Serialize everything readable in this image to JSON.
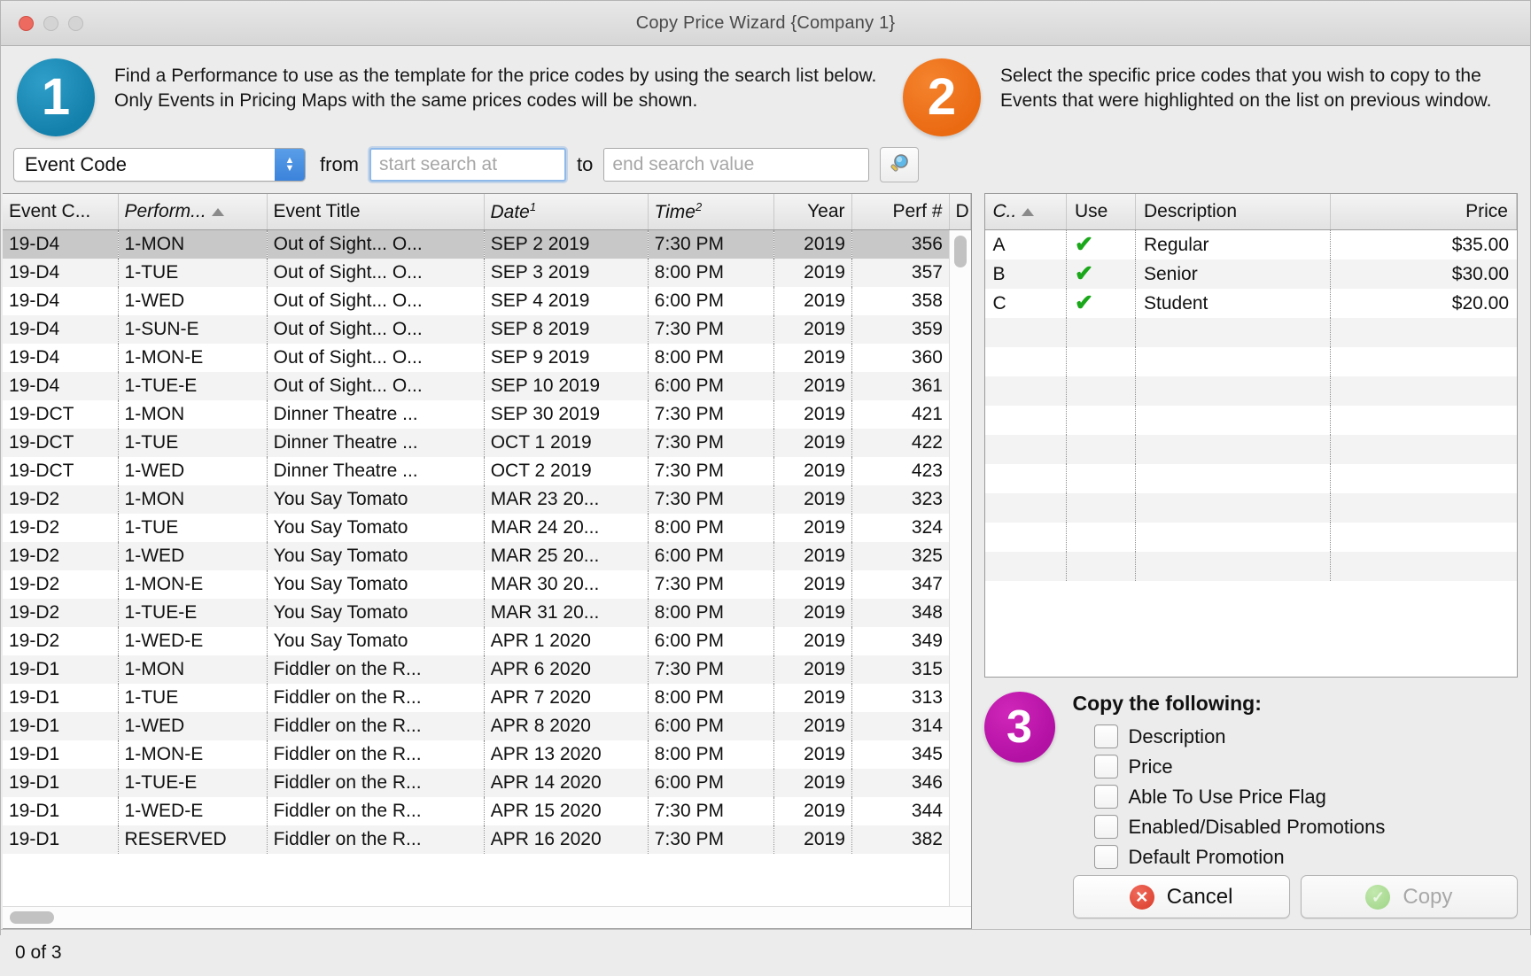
{
  "window": {
    "title": "Copy Price Wizard {Company 1}",
    "traffic_lights": [
      "close",
      "minimize",
      "zoom"
    ]
  },
  "steps": {
    "one": {
      "number": "1",
      "color": "#1380ab",
      "text": "Find a Performance to use as the template for the price codes by using the search list below.  Only Events in Pricing Maps  with the same prices codes will be shown."
    },
    "two": {
      "number": "2",
      "color": "#ea6a12",
      "text": "Select the specific price codes that you wish to copy to the Events that were highlighted on the list on previous window."
    },
    "three": {
      "number": "3",
      "color": "#b310a4",
      "title": "Copy the following:"
    }
  },
  "search": {
    "field_label": "Event Code",
    "from_label": "from",
    "to_label": "to",
    "from_placeholder": "start search at",
    "from_value": "",
    "to_placeholder": "end search value",
    "to_value": "",
    "search_icon": "magnifier-icon"
  },
  "events_table": {
    "columns": [
      {
        "label": "Event C...",
        "italic": false,
        "sup": "",
        "align": "left",
        "sorted": false
      },
      {
        "label": "Perform...",
        "italic": true,
        "sup": "",
        "align": "left",
        "sorted": true
      },
      {
        "label": "Event Title",
        "italic": false,
        "sup": "",
        "align": "left",
        "sorted": false
      },
      {
        "label": "Date",
        "italic": true,
        "sup": "1",
        "align": "left",
        "sorted": false
      },
      {
        "label": "Time",
        "italic": true,
        "sup": "2",
        "align": "left",
        "sorted": false
      },
      {
        "label": "Year",
        "italic": false,
        "sup": "",
        "align": "right",
        "sorted": false
      },
      {
        "label": "Perf #",
        "italic": false,
        "sup": "",
        "align": "right",
        "sorted": false
      },
      {
        "label": "D",
        "italic": false,
        "sup": "",
        "align": "left",
        "sorted": false
      }
    ],
    "rows": [
      {
        "event_code": "19-D4",
        "performance": "1-MON",
        "event_title": "Out of Sight... O...",
        "date": "SEP 2 2019",
        "time": "7:30 PM",
        "year": "2019",
        "perf": "356",
        "selected": true
      },
      {
        "event_code": "19-D4",
        "performance": "1-TUE",
        "event_title": "Out of Sight... O...",
        "date": "SEP 3 2019",
        "time": "8:00 PM",
        "year": "2019",
        "perf": "357",
        "selected": false
      },
      {
        "event_code": "19-D4",
        "performance": "1-WED",
        "event_title": "Out of Sight... O...",
        "date": "SEP 4 2019",
        "time": "6:00 PM",
        "year": "2019",
        "perf": "358",
        "selected": false
      },
      {
        "event_code": "19-D4",
        "performance": "1-SUN-E",
        "event_title": "Out of Sight... O...",
        "date": "SEP 8 2019",
        "time": "7:30 PM",
        "year": "2019",
        "perf": "359",
        "selected": false
      },
      {
        "event_code": "19-D4",
        "performance": "1-MON-E",
        "event_title": "Out of Sight... O...",
        "date": "SEP 9 2019",
        "time": "8:00 PM",
        "year": "2019",
        "perf": "360",
        "selected": false
      },
      {
        "event_code": "19-D4",
        "performance": "1-TUE-E",
        "event_title": "Out of Sight... O...",
        "date": "SEP 10 2019",
        "time": "6:00 PM",
        "year": "2019",
        "perf": "361",
        "selected": false
      },
      {
        "event_code": "19-DCT",
        "performance": "1-MON",
        "event_title": "Dinner Theatre ...",
        "date": "SEP 30 2019",
        "time": "7:30 PM",
        "year": "2019",
        "perf": "421",
        "selected": false
      },
      {
        "event_code": "19-DCT",
        "performance": "1-TUE",
        "event_title": "Dinner Theatre ...",
        "date": "OCT 1 2019",
        "time": "7:30 PM",
        "year": "2019",
        "perf": "422",
        "selected": false
      },
      {
        "event_code": "19-DCT",
        "performance": "1-WED",
        "event_title": "Dinner Theatre ...",
        "date": "OCT 2 2019",
        "time": "7:30 PM",
        "year": "2019",
        "perf": "423",
        "selected": false
      },
      {
        "event_code": "19-D2",
        "performance": "1-MON",
        "event_title": "You Say Tomato",
        "date": "MAR 23 20...",
        "time": "7:30 PM",
        "year": "2019",
        "perf": "323",
        "selected": false
      },
      {
        "event_code": "19-D2",
        "performance": "1-TUE",
        "event_title": "You Say Tomato",
        "date": "MAR 24 20...",
        "time": "8:00 PM",
        "year": "2019",
        "perf": "324",
        "selected": false
      },
      {
        "event_code": "19-D2",
        "performance": "1-WED",
        "event_title": "You Say Tomato",
        "date": "MAR 25 20...",
        "time": "6:00 PM",
        "year": "2019",
        "perf": "325",
        "selected": false
      },
      {
        "event_code": "19-D2",
        "performance": "1-MON-E",
        "event_title": "You Say Tomato",
        "date": "MAR 30 20...",
        "time": "7:30 PM",
        "year": "2019",
        "perf": "347",
        "selected": false
      },
      {
        "event_code": "19-D2",
        "performance": "1-TUE-E",
        "event_title": "You Say Tomato",
        "date": "MAR 31 20...",
        "time": "8:00 PM",
        "year": "2019",
        "perf": "348",
        "selected": false
      },
      {
        "event_code": "19-D2",
        "performance": "1-WED-E",
        "event_title": "You Say Tomato",
        "date": "APR 1 2020",
        "time": "6:00 PM",
        "year": "2019",
        "perf": "349",
        "selected": false
      },
      {
        "event_code": "19-D1",
        "performance": "1-MON",
        "event_title": "Fiddler on the R...",
        "date": "APR 6 2020",
        "time": "7:30 PM",
        "year": "2019",
        "perf": "315",
        "selected": false
      },
      {
        "event_code": "19-D1",
        "performance": "1-TUE",
        "event_title": "Fiddler on the R...",
        "date": "APR 7 2020",
        "time": "8:00 PM",
        "year": "2019",
        "perf": "313",
        "selected": false
      },
      {
        "event_code": "19-D1",
        "performance": "1-WED",
        "event_title": "Fiddler on the R...",
        "date": "APR 8 2020",
        "time": "6:00 PM",
        "year": "2019",
        "perf": "314",
        "selected": false
      },
      {
        "event_code": "19-D1",
        "performance": "1-MON-E",
        "event_title": "Fiddler on the R...",
        "date": "APR 13 2020",
        "time": "8:00 PM",
        "year": "2019",
        "perf": "345",
        "selected": false
      },
      {
        "event_code": "19-D1",
        "performance": "1-TUE-E",
        "event_title": "Fiddler on the R...",
        "date": "APR 14 2020",
        "time": "6:00 PM",
        "year": "2019",
        "perf": "346",
        "selected": false
      },
      {
        "event_code": "19-D1",
        "performance": "1-WED-E",
        "event_title": "Fiddler on the R...",
        "date": "APR 15 2020",
        "time": "7:30 PM",
        "year": "2019",
        "perf": "344",
        "selected": false
      },
      {
        "event_code": "19-D1",
        "performance": "RESERVED",
        "event_title": "Fiddler on the R...",
        "date": "APR 16 2020",
        "time": "7:30 PM",
        "year": "2019",
        "perf": "382",
        "selected": false
      }
    ]
  },
  "price_table": {
    "columns": [
      {
        "label": "C..",
        "italic": true,
        "align": "left",
        "sorted": true
      },
      {
        "label": "Use",
        "italic": false,
        "align": "left",
        "sorted": false
      },
      {
        "label": "Description",
        "italic": false,
        "align": "left",
        "sorted": false
      },
      {
        "label": "Price",
        "italic": false,
        "align": "right",
        "sorted": false
      }
    ],
    "rows": [
      {
        "code": "A",
        "use": "✔",
        "description": "Regular",
        "price": "$35.00"
      },
      {
        "code": "B",
        "use": "✔",
        "description": "Senior",
        "price": "$30.00"
      },
      {
        "code": "C",
        "use": "✔",
        "description": "Student",
        "price": "$20.00"
      }
    ],
    "check_color": "#1aa81a"
  },
  "copy_options": [
    {
      "label": "Description",
      "checked": false
    },
    {
      "label": "Price",
      "checked": false
    },
    {
      "label": "Able To Use Price Flag",
      "checked": false
    },
    {
      "label": "Enabled/Disabled Promotions",
      "checked": false
    },
    {
      "label": "Default Promotion",
      "checked": false
    }
  ],
  "buttons": {
    "cancel": {
      "label": "Cancel",
      "icon": "error-circle-icon",
      "enabled": true
    },
    "copy": {
      "label": "Copy",
      "icon": "check-circle-icon",
      "enabled": false
    }
  },
  "status": {
    "text": "0 of 3"
  }
}
